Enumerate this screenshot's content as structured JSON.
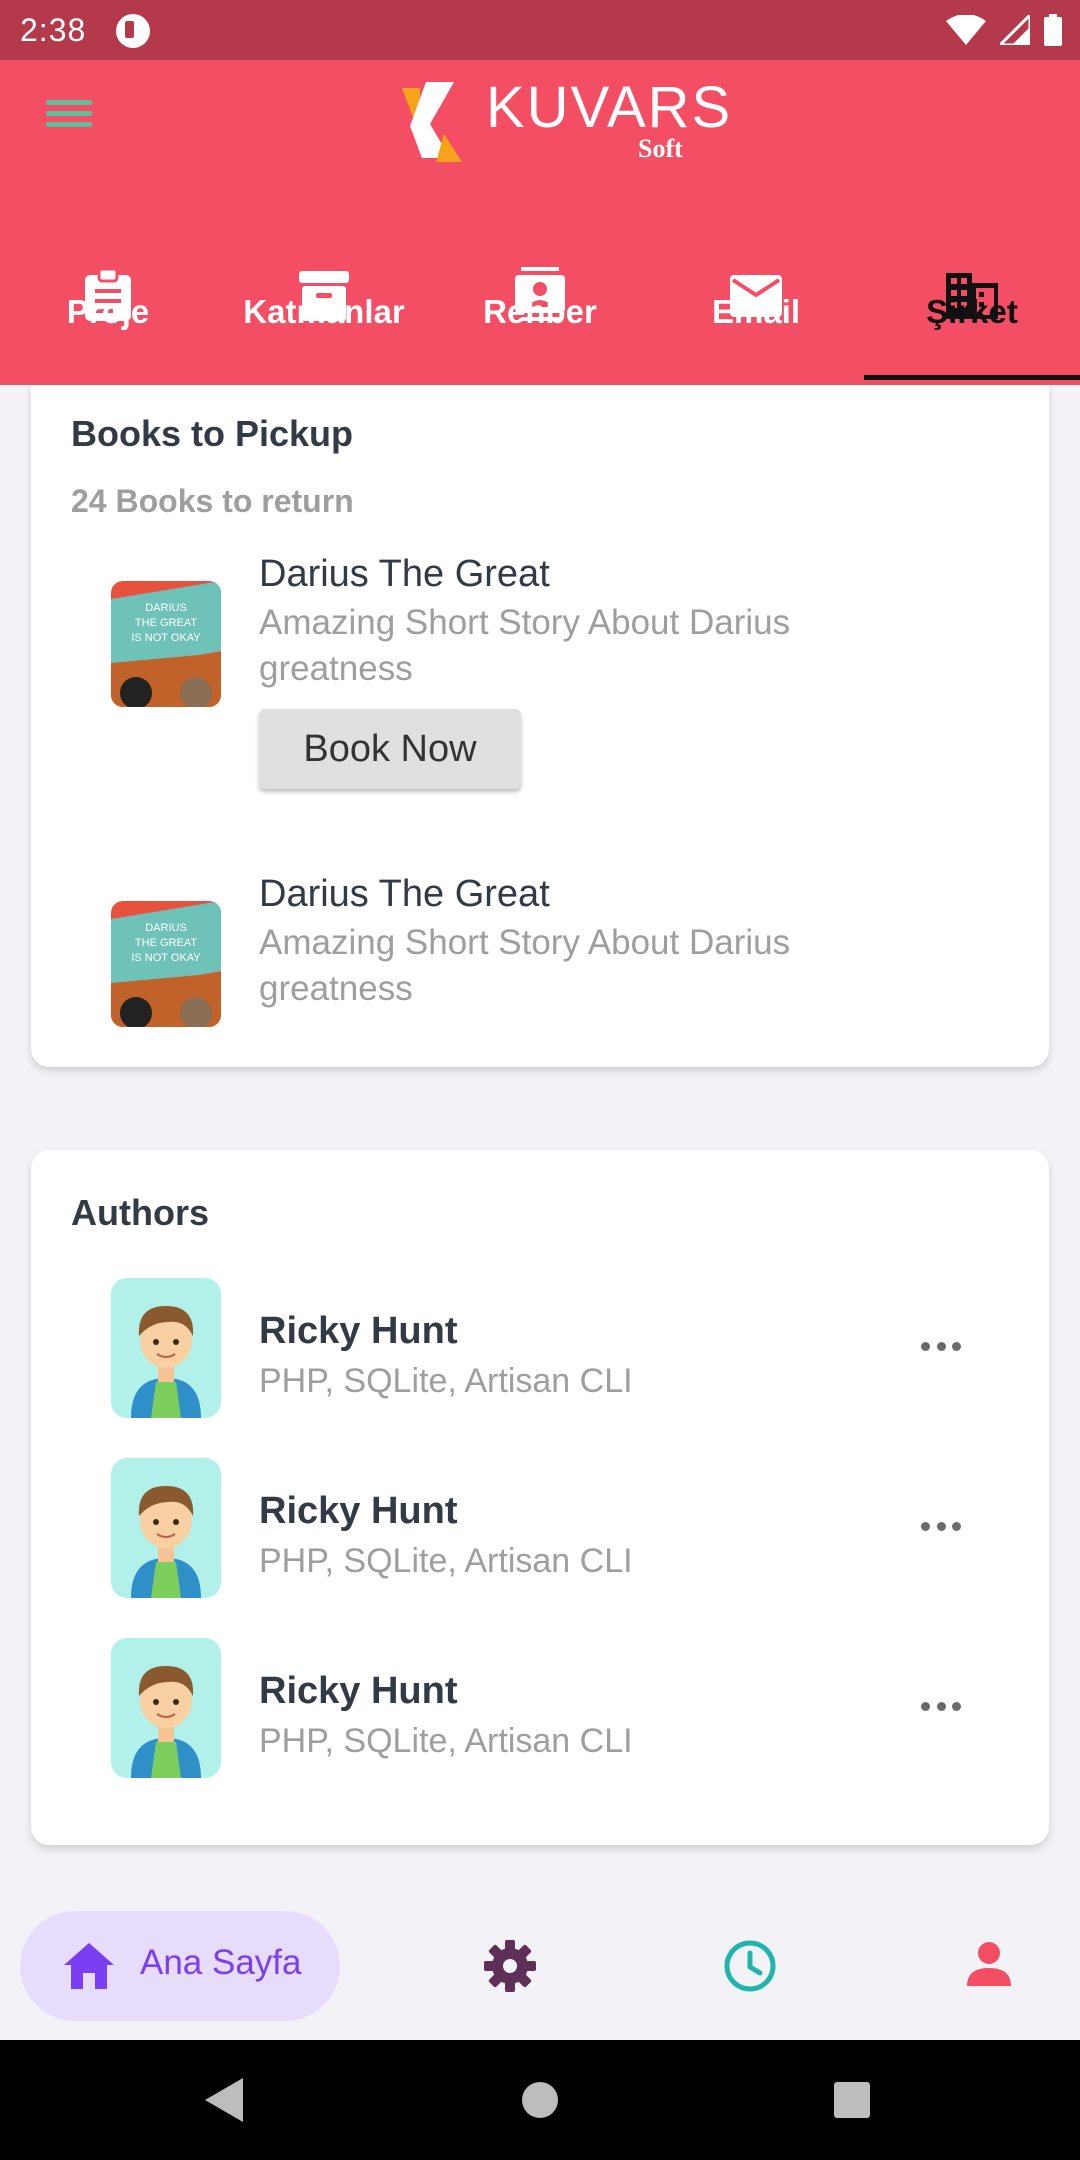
{
  "status_bar": {
    "time": "2:38"
  },
  "header": {
    "logo_text": "KUVARS",
    "logo_sub": "Soft",
    "tabs": [
      {
        "label": "Proje",
        "icon": "clipboard-icon"
      },
      {
        "label": "Katmanlar",
        "icon": "archive-icon"
      },
      {
        "label": "Rehber",
        "icon": "contacts-icon"
      },
      {
        "label": "Email",
        "icon": "mail-icon"
      },
      {
        "label": "Şirket",
        "icon": "building-icon",
        "active": true
      }
    ]
  },
  "books": {
    "title": "Books to Pickup",
    "subtitle": "24 Books to return",
    "items": [
      {
        "title": "Darius The Great",
        "desc": "Amazing Short Story About Darius greatness",
        "button": "Book Now"
      },
      {
        "title": "Darius The Great",
        "desc": "Amazing Short Story About Darius greatness"
      }
    ],
    "cover_text": [
      "DARIUS",
      "THE GREAT",
      "IS NOT OKAY"
    ]
  },
  "authors": {
    "title": "Authors",
    "items": [
      {
        "name": "Ricky Hunt",
        "skills": "PHP, SQLite, Artisan CLI"
      },
      {
        "name": "Ricky Hunt",
        "skills": "PHP, SQLite, Artisan CLI"
      },
      {
        "name": "Ricky Hunt",
        "skills": "PHP, SQLite, Artisan CLI"
      }
    ]
  },
  "bottom_nav": {
    "home_label": "Ana Sayfa",
    "items": [
      "home-icon",
      "settings-icon",
      "clock-icon",
      "profile-icon"
    ]
  },
  "colors": {
    "status_bar": "#b43a4b",
    "header": "#f34e63",
    "accent_purple": "#7a3ff2",
    "settings_purple": "#5e2f59",
    "clock_teal": "#1fb5ad",
    "profile_red": "#f34e63"
  }
}
